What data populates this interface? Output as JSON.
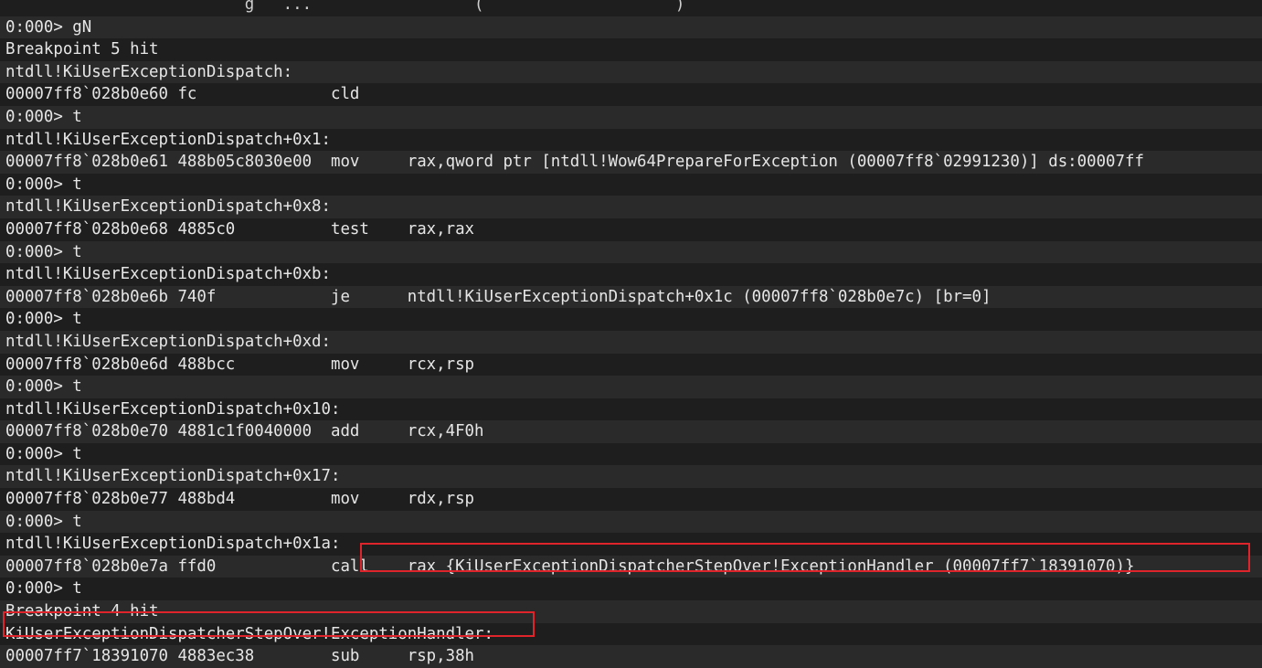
{
  "console": {
    "lines": [
      "                         g   ...                 (                    )",
      "0:000> gN",
      "Breakpoint 5 hit",
      "ntdll!KiUserExceptionDispatch:",
      "00007ff8`028b0e60 fc              cld",
      "0:000> t",
      "ntdll!KiUserExceptionDispatch+0x1:",
      "00007ff8`028b0e61 488b05c8030e00  mov     rax,qword ptr [ntdll!Wow64PrepareForException (00007ff8`02991230)] ds:00007ff",
      "0:000> t",
      "ntdll!KiUserExceptionDispatch+0x8:",
      "00007ff8`028b0e68 4885c0          test    rax,rax",
      "0:000> t",
      "ntdll!KiUserExceptionDispatch+0xb:",
      "00007ff8`028b0e6b 740f            je      ntdll!KiUserExceptionDispatch+0x1c (00007ff8`028b0e7c) [br=0]",
      "0:000> t",
      "ntdll!KiUserExceptionDispatch+0xd:",
      "00007ff8`028b0e6d 488bcc          mov     rcx,rsp",
      "0:000> t",
      "ntdll!KiUserExceptionDispatch+0x10:",
      "00007ff8`028b0e70 4881c1f0040000  add     rcx,4F0h",
      "0:000> t",
      "ntdll!KiUserExceptionDispatch+0x17:",
      "00007ff8`028b0e77 488bd4          mov     rdx,rsp",
      "0:000> t",
      "ntdll!KiUserExceptionDispatch+0x1a:",
      "00007ff8`028b0e7a ffd0            call    rax {KiUserExceptionDispatcherStepOver!ExceptionHandler (00007ff7`18391070)}",
      "0:000> t",
      "Breakpoint 4 hit",
      "KiUserExceptionDispatcherStepOver!ExceptionHandler:",
      "00007ff7`18391070 4883ec38        sub     rsp,38h"
    ]
  },
  "colors": {
    "background": "#1e1e1e",
    "alt_row": "#2a2a2a",
    "text": "#e6e6e6",
    "highlight_border": "#e0242c"
  }
}
